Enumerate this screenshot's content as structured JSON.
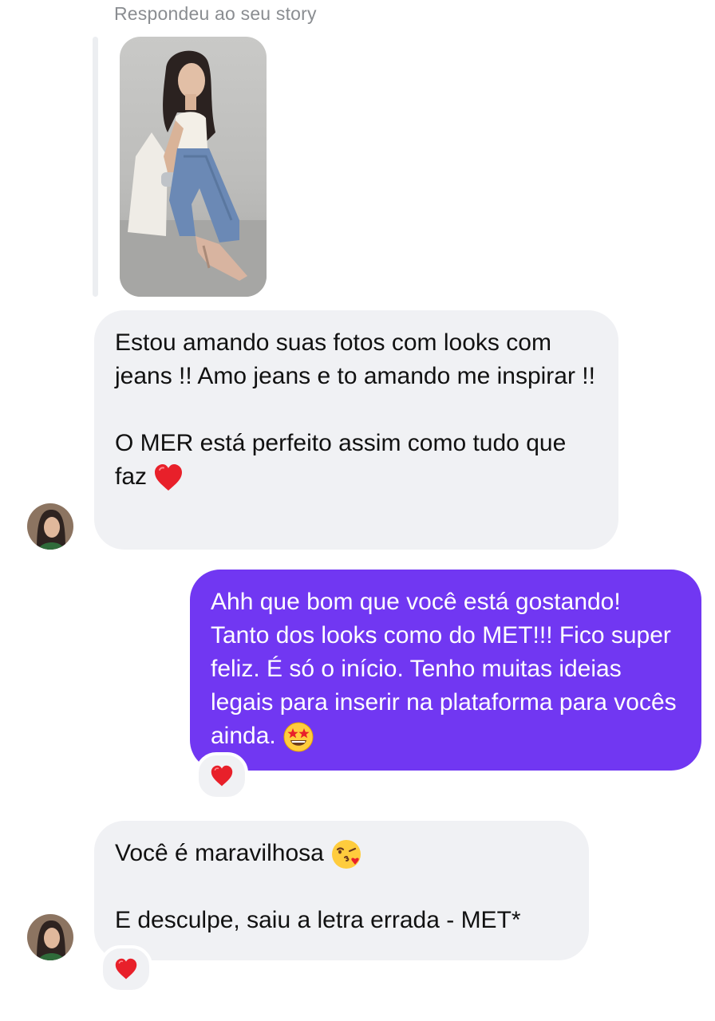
{
  "thread": {
    "reply_label": "Respondeu ao seu story",
    "messages": [
      {
        "sender": "contact",
        "text": "Estou amando suas fotos com looks com jeans !! Amo jeans e to amando me inspirar !!\n\nO MER está perfeito assim como tudo que faz",
        "emoji": "red-heart"
      },
      {
        "sender": "me",
        "text": "Ahh que bom que você está gostando! Tanto dos looks como do MET!!! Fico super feliz. É só o início. Tenho muitas ideias legais para inserir na plataforma para vocês ainda.",
        "emoji": "star-struck",
        "reaction": "red-heart"
      },
      {
        "sender": "contact",
        "text_line1": "Você é maravilhosa",
        "emoji": "face-blowing-kiss",
        "text_line2": "E desculpe, saiu a letra errada - MET*",
        "reaction": "red-heart"
      }
    ]
  },
  "colors": {
    "outgoing_bubble": "#7137f2",
    "incoming_bubble": "#f0f1f4",
    "meta_text": "#8a8d91"
  }
}
